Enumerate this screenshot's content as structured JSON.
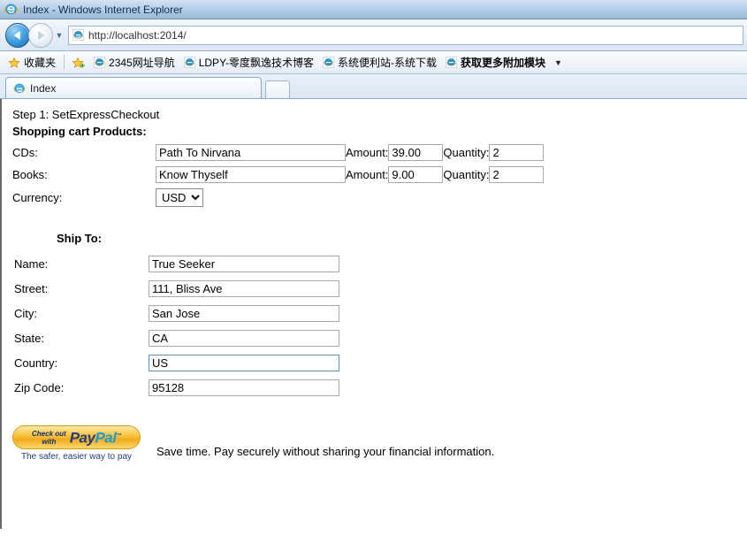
{
  "window": {
    "title": "Index - Windows Internet Explorer",
    "app_icon": "internet-explorer-icon"
  },
  "navigation": {
    "back_label": "Back",
    "forward_label": "Forward",
    "recent_pages_label": "Recent Pages",
    "address_url": "http://localhost:2014/",
    "address_scheme": "http://",
    "address_host": "localhost:2014/"
  },
  "favorites_bar": {
    "favorites_button": "收藏夹",
    "add_to_favorites_label": "添加到收藏夹栏",
    "items": [
      {
        "label": "2345网址导航",
        "bold": false
      },
      {
        "label": "LDPY-零度飘逸技术博客",
        "bold": false
      },
      {
        "label": "系统便利站-系统下载",
        "bold": false
      },
      {
        "label": "获取更多附加模块",
        "bold": true
      }
    ],
    "overflow_label": "▼"
  },
  "tabs": {
    "items": [
      {
        "label": "Index"
      }
    ],
    "new_tab_label": ""
  },
  "page": {
    "step_line": "Step 1: SetExpressCheckout",
    "cart_heading": "Shopping cart Products:",
    "cart_rows": [
      {
        "label": "CDs:",
        "product": "Path To Nirvana",
        "amount_label": "Amount:",
        "amount": "39.00",
        "quantity_label": "Quantity:",
        "quantity": "2"
      },
      {
        "label": "Books:",
        "product": "Know Thyself",
        "amount_label": "Amount:",
        "amount": "9.00",
        "quantity_label": "Quantity:",
        "quantity": "2"
      }
    ],
    "currency_label": "Currency:",
    "currency_value": "USD",
    "currency_options": [
      "USD"
    ],
    "shipto_heading": "Ship To:",
    "shipto_fields": [
      {
        "label": "Name:",
        "value": "True Seeker",
        "focused": false
      },
      {
        "label": "Street:",
        "value": "111, Bliss Ave",
        "focused": false
      },
      {
        "label": "City:",
        "value": "San Jose",
        "focused": false
      },
      {
        "label": "State:",
        "value": "CA",
        "focused": false
      },
      {
        "label": "Country:",
        "value": "US",
        "focused": true
      },
      {
        "label": "Zip Code:",
        "value": "95128",
        "focused": false
      }
    ],
    "paypal": {
      "checkout_line1": "Check out",
      "checkout_line2": "with",
      "brand_pay": "Pay",
      "brand_pal": "Pal",
      "tagline": "The safer, easier way to pay",
      "note": "Save time. Pay securely without sharing your financial information."
    }
  },
  "colors": {
    "titlebar_top": "#d5e3f2",
    "titlebar_bottom": "#9ab8d8",
    "paypal_gold": "#f0ac1e",
    "paypal_blue": "#253b80",
    "paypal_lightblue": "#179bd7",
    "focus_border": "#5a8fc4"
  }
}
